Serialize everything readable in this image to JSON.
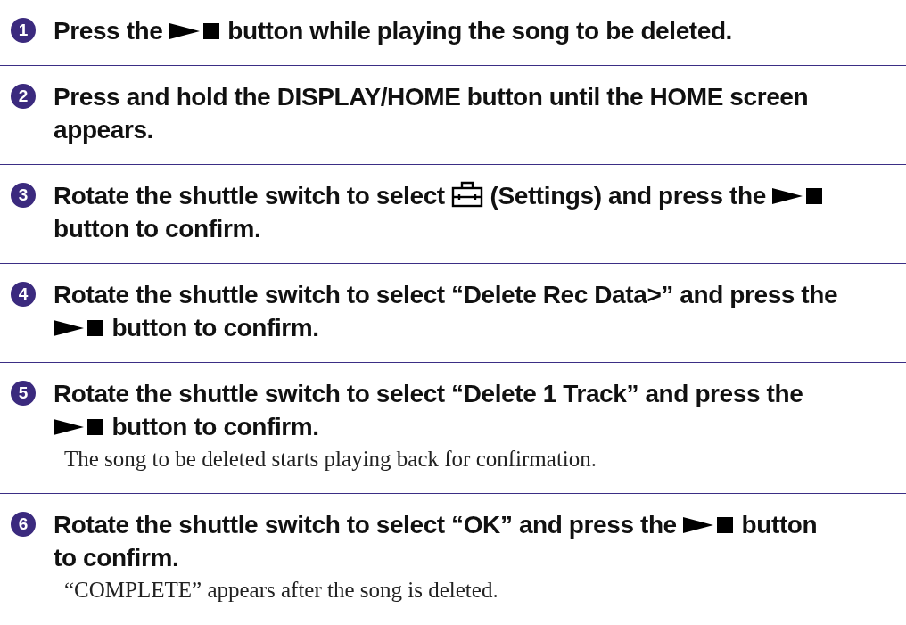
{
  "steps": [
    {
      "number": "1",
      "lines": [
        [
          {
            "kind": "text",
            "text": "Press the"
          },
          {
            "kind": "play-stop"
          },
          {
            "kind": "text",
            "text": "button while playing the song to be deleted."
          }
        ]
      ]
    },
    {
      "number": "2",
      "lines": [
        [
          {
            "kind": "text",
            "text": "Press and hold the DISPLAY/HOME button until the HOME screen"
          }
        ],
        [
          {
            "kind": "text",
            "text": "appears."
          }
        ]
      ]
    },
    {
      "number": "3",
      "lines": [
        [
          {
            "kind": "text",
            "text": "Rotate the shuttle switch to select"
          },
          {
            "kind": "toolbox"
          },
          {
            "kind": "text",
            "text": "(Settings) and press the"
          },
          {
            "kind": "play-stop"
          }
        ],
        [
          {
            "kind": "text",
            "text": "button to confirm."
          }
        ]
      ]
    },
    {
      "number": "4",
      "lines": [
        [
          {
            "kind": "text",
            "text": "Rotate the shuttle switch to select “Delete Rec Data>” and press the"
          }
        ],
        [
          {
            "kind": "play-stop"
          },
          {
            "kind": "text",
            "text": "button to confirm."
          }
        ]
      ]
    },
    {
      "number": "5",
      "lines": [
        [
          {
            "kind": "text",
            "text": "Rotate the shuttle switch to select “Delete 1 Track” and press the"
          }
        ],
        [
          {
            "kind": "play-stop"
          },
          {
            "kind": "text",
            "text": "button to confirm."
          }
        ]
      ],
      "note": "The song to be deleted starts playing back for confirmation."
    },
    {
      "number": "6",
      "lines": [
        [
          {
            "kind": "text",
            "text": "Rotate the shuttle switch to select “OK” and press the"
          },
          {
            "kind": "play-stop"
          },
          {
            "kind": "text",
            "text": "button"
          }
        ],
        [
          {
            "kind": "text",
            "text": "to confirm."
          }
        ]
      ],
      "note": "“COMPLETE” appears after the song is deleted."
    }
  ]
}
